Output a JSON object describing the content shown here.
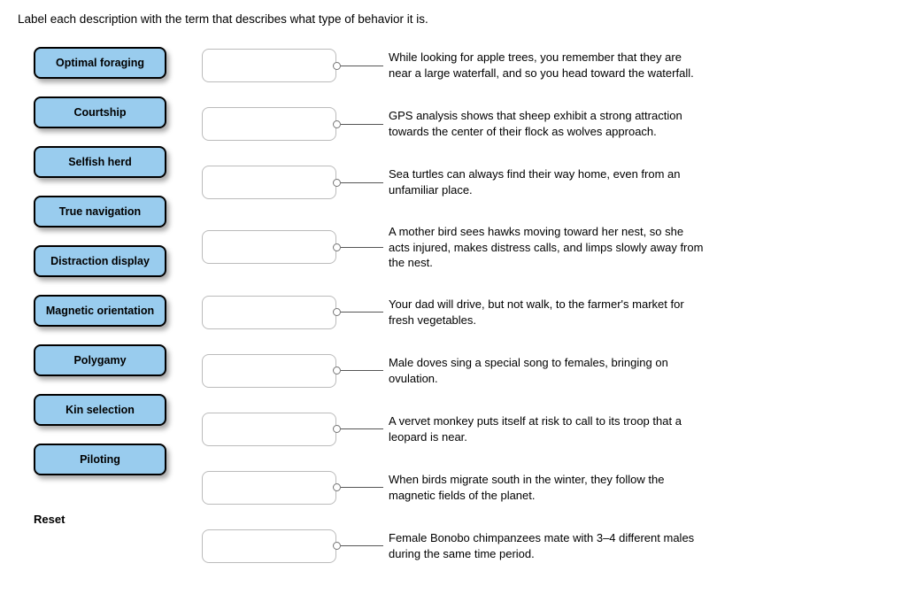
{
  "prompt": "Label each description with the term that describes what type of behavior it is.",
  "terms": [
    "Optimal foraging",
    "Courtship",
    "Selfish herd",
    "True navigation",
    "Distraction display",
    "Magnetic orientation",
    "Polygamy",
    "Kin selection",
    "Piloting"
  ],
  "descriptions": [
    "While looking for apple trees, you remember that they are near a large waterfall, and so you head toward the waterfall.",
    "GPS analysis shows that sheep exhibit a strong attraction towards the center of their flock as wolves approach.",
    "Sea turtles can always find their way home, even from an unfamiliar place.",
    "A mother bird sees hawks moving toward her nest, so she acts injured, makes distress calls, and limps slowly away from the nest.",
    "Your dad will drive, but not walk, to the farmer's market for fresh vegetables.",
    "Male doves sing a special song to females, bringing on ovulation.",
    "A vervet monkey puts itself at risk to call to its troop that a leopard is near.",
    "When birds migrate south in the winter, they follow the magnetic fields of the planet.",
    "Female Bonobo chimpanzees mate with 3–4 different males during the same time period."
  ],
  "reset_label": "Reset"
}
